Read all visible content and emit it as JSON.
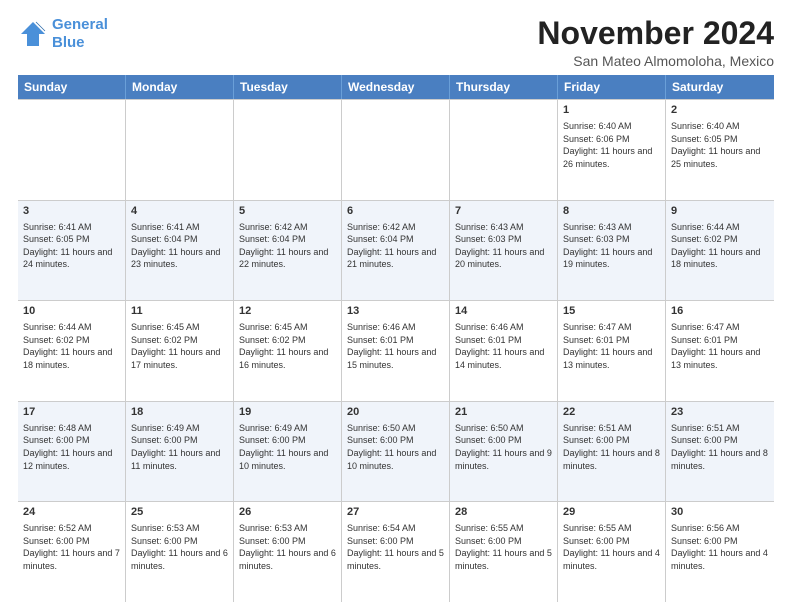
{
  "logo": {
    "line1": "General",
    "line2": "Blue"
  },
  "title": "November 2024",
  "location": "San Mateo Almomoloha, Mexico",
  "headers": [
    "Sunday",
    "Monday",
    "Tuesday",
    "Wednesday",
    "Thursday",
    "Friday",
    "Saturday"
  ],
  "rows": [
    [
      {
        "day": "",
        "info": "",
        "empty": true
      },
      {
        "day": "",
        "info": "",
        "empty": true
      },
      {
        "day": "",
        "info": "",
        "empty": true
      },
      {
        "day": "",
        "info": "",
        "empty": true
      },
      {
        "day": "",
        "info": "",
        "empty": true
      },
      {
        "day": "1",
        "info": "Sunrise: 6:40 AM\nSunset: 6:06 PM\nDaylight: 11 hours and 26 minutes."
      },
      {
        "day": "2",
        "info": "Sunrise: 6:40 AM\nSunset: 6:05 PM\nDaylight: 11 hours and 25 minutes."
      }
    ],
    [
      {
        "day": "3",
        "info": "Sunrise: 6:41 AM\nSunset: 6:05 PM\nDaylight: 11 hours and 24 minutes."
      },
      {
        "day": "4",
        "info": "Sunrise: 6:41 AM\nSunset: 6:04 PM\nDaylight: 11 hours and 23 minutes."
      },
      {
        "day": "5",
        "info": "Sunrise: 6:42 AM\nSunset: 6:04 PM\nDaylight: 11 hours and 22 minutes."
      },
      {
        "day": "6",
        "info": "Sunrise: 6:42 AM\nSunset: 6:04 PM\nDaylight: 11 hours and 21 minutes."
      },
      {
        "day": "7",
        "info": "Sunrise: 6:43 AM\nSunset: 6:03 PM\nDaylight: 11 hours and 20 minutes."
      },
      {
        "day": "8",
        "info": "Sunrise: 6:43 AM\nSunset: 6:03 PM\nDaylight: 11 hours and 19 minutes."
      },
      {
        "day": "9",
        "info": "Sunrise: 6:44 AM\nSunset: 6:02 PM\nDaylight: 11 hours and 18 minutes."
      }
    ],
    [
      {
        "day": "10",
        "info": "Sunrise: 6:44 AM\nSunset: 6:02 PM\nDaylight: 11 hours and 18 minutes."
      },
      {
        "day": "11",
        "info": "Sunrise: 6:45 AM\nSunset: 6:02 PM\nDaylight: 11 hours and 17 minutes."
      },
      {
        "day": "12",
        "info": "Sunrise: 6:45 AM\nSunset: 6:02 PM\nDaylight: 11 hours and 16 minutes."
      },
      {
        "day": "13",
        "info": "Sunrise: 6:46 AM\nSunset: 6:01 PM\nDaylight: 11 hours and 15 minutes."
      },
      {
        "day": "14",
        "info": "Sunrise: 6:46 AM\nSunset: 6:01 PM\nDaylight: 11 hours and 14 minutes."
      },
      {
        "day": "15",
        "info": "Sunrise: 6:47 AM\nSunset: 6:01 PM\nDaylight: 11 hours and 13 minutes."
      },
      {
        "day": "16",
        "info": "Sunrise: 6:47 AM\nSunset: 6:01 PM\nDaylight: 11 hours and 13 minutes."
      }
    ],
    [
      {
        "day": "17",
        "info": "Sunrise: 6:48 AM\nSunset: 6:00 PM\nDaylight: 11 hours and 12 minutes."
      },
      {
        "day": "18",
        "info": "Sunrise: 6:49 AM\nSunset: 6:00 PM\nDaylight: 11 hours and 11 minutes."
      },
      {
        "day": "19",
        "info": "Sunrise: 6:49 AM\nSunset: 6:00 PM\nDaylight: 11 hours and 10 minutes."
      },
      {
        "day": "20",
        "info": "Sunrise: 6:50 AM\nSunset: 6:00 PM\nDaylight: 11 hours and 10 minutes."
      },
      {
        "day": "21",
        "info": "Sunrise: 6:50 AM\nSunset: 6:00 PM\nDaylight: 11 hours and 9 minutes."
      },
      {
        "day": "22",
        "info": "Sunrise: 6:51 AM\nSunset: 6:00 PM\nDaylight: 11 hours and 8 minutes."
      },
      {
        "day": "23",
        "info": "Sunrise: 6:51 AM\nSunset: 6:00 PM\nDaylight: 11 hours and 8 minutes."
      }
    ],
    [
      {
        "day": "24",
        "info": "Sunrise: 6:52 AM\nSunset: 6:00 PM\nDaylight: 11 hours and 7 minutes."
      },
      {
        "day": "25",
        "info": "Sunrise: 6:53 AM\nSunset: 6:00 PM\nDaylight: 11 hours and 6 minutes."
      },
      {
        "day": "26",
        "info": "Sunrise: 6:53 AM\nSunset: 6:00 PM\nDaylight: 11 hours and 6 minutes."
      },
      {
        "day": "27",
        "info": "Sunrise: 6:54 AM\nSunset: 6:00 PM\nDaylight: 11 hours and 5 minutes."
      },
      {
        "day": "28",
        "info": "Sunrise: 6:55 AM\nSunset: 6:00 PM\nDaylight: 11 hours and 5 minutes."
      },
      {
        "day": "29",
        "info": "Sunrise: 6:55 AM\nSunset: 6:00 PM\nDaylight: 11 hours and 4 minutes."
      },
      {
        "day": "30",
        "info": "Sunrise: 6:56 AM\nSunset: 6:00 PM\nDaylight: 11 hours and 4 minutes."
      }
    ]
  ]
}
